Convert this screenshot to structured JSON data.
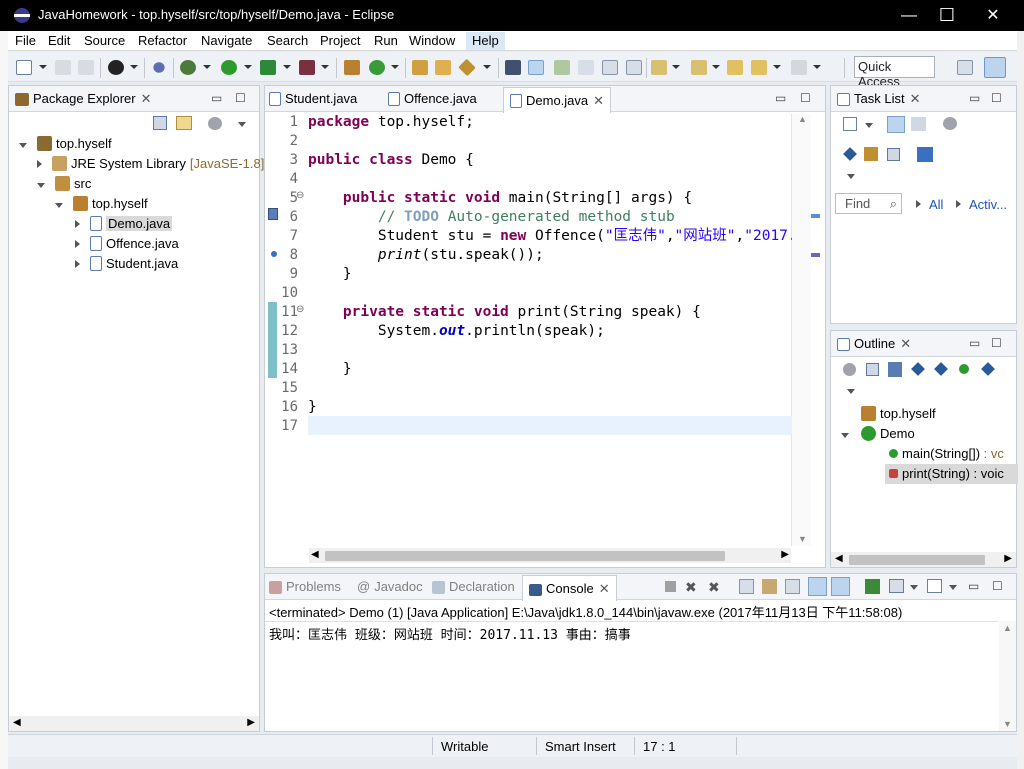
{
  "window": {
    "title": "JavaHomework - top.hyself/src/top/hyself/Demo.java - Eclipse",
    "min": "—",
    "max": "☐",
    "close": "✕"
  },
  "menu": [
    "File",
    "Edit",
    "Source",
    "Refactor",
    "Navigate",
    "Search",
    "Project",
    "Run",
    "Window",
    "Help"
  ],
  "quick_access": "Quick Access",
  "package_explorer": {
    "title": "Package Explorer",
    "tree": [
      {
        "label": "top.hyself",
        "indent": 0,
        "expanded": true,
        "icon": "project-icon"
      },
      {
        "label": "JRE System Library",
        "suffix": "[JavaSE-1.8]",
        "indent": 1,
        "expanded": false,
        "icon": "library-icon"
      },
      {
        "label": "src",
        "indent": 1,
        "expanded": true,
        "icon": "source-folder-icon"
      },
      {
        "label": "top.hyself",
        "indent": 2,
        "expanded": true,
        "icon": "package-icon"
      },
      {
        "label": "Demo.java",
        "indent": 3,
        "expanded": false,
        "icon": "java-file-icon",
        "selected": true
      },
      {
        "label": "Offence.java",
        "indent": 3,
        "expanded": false,
        "icon": "java-file-icon"
      },
      {
        "label": "Student.java",
        "indent": 3,
        "expanded": false,
        "icon": "java-file-icon"
      }
    ]
  },
  "editor": {
    "tabs": [
      "Student.java",
      "Offence.java",
      "Demo.java"
    ],
    "active_tab": "Demo.java",
    "line_numbers": [
      "1",
      "2",
      "3",
      "4",
      "5",
      "6",
      "7",
      "8",
      "9",
      "10",
      "11",
      "12",
      "13",
      "14",
      "15",
      "16",
      "17"
    ]
  },
  "task_list": {
    "title": "Task List",
    "find": "Find",
    "all": "All",
    "activ": "Activ..."
  },
  "outline": {
    "title": "Outline",
    "items": [
      {
        "label": "top.hyself",
        "icon": "package-icon"
      },
      {
        "label": "Demo",
        "icon": "class-icon"
      },
      {
        "label": "main(String[])",
        "suffix": " : vc",
        "icon": "public-method-icon"
      },
      {
        "label": "print(String)",
        "suffix": " : voic",
        "icon": "private-method-icon",
        "selected": true
      }
    ]
  },
  "bottom": {
    "tabs": [
      "Problems",
      "Javadoc",
      "Declaration",
      "Console"
    ],
    "active_tab": "Console",
    "console_header": "<terminated> Demo (1) [Java Application] E:\\Java\\jdk1.8.0_144\\bin\\javaw.exe (2017年11月13日 下午11:58:08)",
    "console_output": "我叫：匡志伟 班级：网站班 时间：2017.11.13 事由：搞事"
  },
  "status": {
    "writable": "Writable",
    "insert_mode": "Smart Insert",
    "position": "17 : 1"
  },
  "colors": {
    "keyword": "#7f0055",
    "comment": "#3f7f5f",
    "string": "#2a00ff",
    "current_line": "#e8f2fe"
  }
}
